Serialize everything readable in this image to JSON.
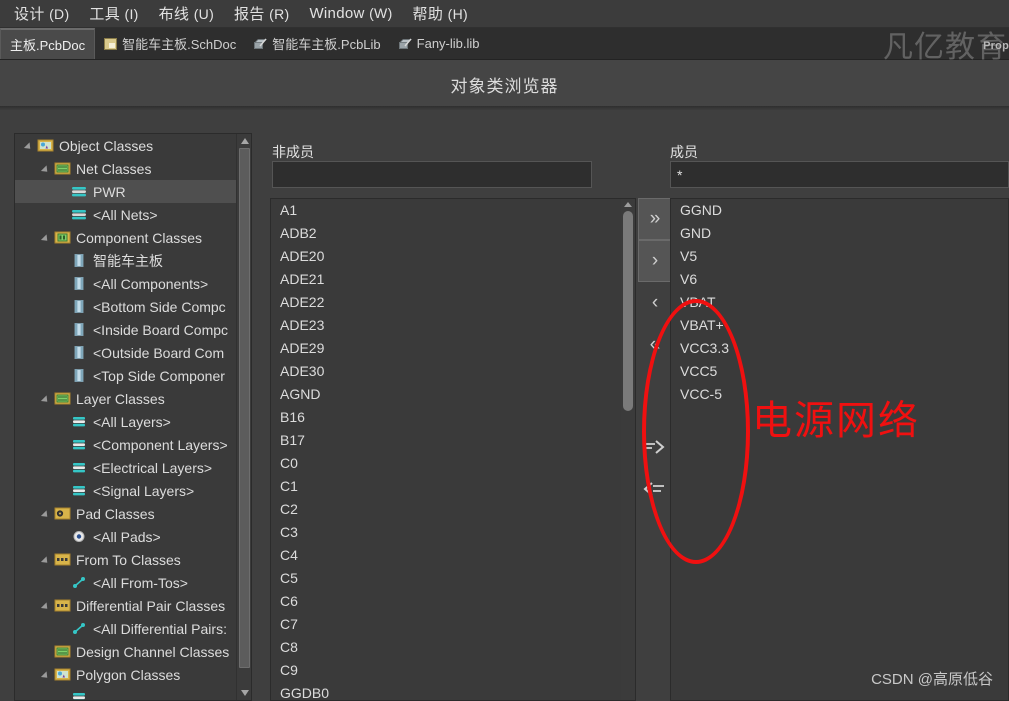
{
  "menubar": {
    "items": [
      {
        "label": "设计",
        "mnemonic": "(D)"
      },
      {
        "label": "工具",
        "mnemonic": "(I)"
      },
      {
        "label": "布线",
        "mnemonic": "(U)"
      },
      {
        "label": "报告",
        "mnemonic": "(R)"
      },
      {
        "label": "Window",
        "mnemonic": "(W)"
      },
      {
        "label": "帮助",
        "mnemonic": "(H)"
      }
    ]
  },
  "tabbar": {
    "tabs": [
      {
        "label": "主板.PcbDoc",
        "icon": "pcb-doc-icon",
        "active": true
      },
      {
        "label": "智能车主板.SchDoc",
        "icon": "sch-doc-icon",
        "active": false
      },
      {
        "label": "智能车主板.PcbLib",
        "icon": "pcb-lib-icon",
        "active": false
      },
      {
        "label": "Fany-lib.lib",
        "icon": "lib-icon",
        "active": false
      }
    ]
  },
  "watermarks": {
    "top_right": "凡亿教育",
    "properties_ghost": "Prop",
    "bottom_right": "CSDN @高原低谷"
  },
  "dialog": {
    "title": "对象类浏览器"
  },
  "tree": {
    "items": [
      {
        "label": "Object Classes",
        "depth": 0,
        "icon": "polygon-class-folder-icon",
        "expander": true,
        "selected": false
      },
      {
        "label": "Net Classes",
        "depth": 1,
        "icon": "net-class-folder-icon",
        "expander": true,
        "selected": false
      },
      {
        "label": "PWR",
        "depth": 2,
        "icon": "net-icon",
        "expander": false,
        "selected": true
      },
      {
        "label": "<All Nets>",
        "depth": 2,
        "icon": "net-icon",
        "expander": false,
        "selected": false
      },
      {
        "label": "Component Classes",
        "depth": 1,
        "icon": "component-class-folder-icon",
        "expander": true,
        "selected": false
      },
      {
        "label": "智能车主板",
        "depth": 2,
        "icon": "component-icon",
        "expander": false,
        "selected": false
      },
      {
        "label": "<All Components>",
        "depth": 2,
        "icon": "component-icon",
        "expander": false,
        "selected": false
      },
      {
        "label": "<Bottom Side Compc",
        "depth": 2,
        "icon": "component-icon",
        "expander": false,
        "selected": false
      },
      {
        "label": "<Inside Board Compc",
        "depth": 2,
        "icon": "component-icon",
        "expander": false,
        "selected": false
      },
      {
        "label": "<Outside Board Com",
        "depth": 2,
        "icon": "component-icon",
        "expander": false,
        "selected": false
      },
      {
        "label": "<Top Side Componer",
        "depth": 2,
        "icon": "component-icon",
        "expander": false,
        "selected": false
      },
      {
        "label": "Layer Classes",
        "depth": 1,
        "icon": "layer-class-folder-icon",
        "expander": true,
        "selected": false
      },
      {
        "label": "<All Layers>",
        "depth": 2,
        "icon": "layer-icon",
        "expander": false,
        "selected": false
      },
      {
        "label": "<Component Layers>",
        "depth": 2,
        "icon": "layer-icon",
        "expander": false,
        "selected": false
      },
      {
        "label": "<Electrical Layers>",
        "depth": 2,
        "icon": "layer-icon",
        "expander": false,
        "selected": false
      },
      {
        "label": "<Signal Layers>",
        "depth": 2,
        "icon": "layer-icon",
        "expander": false,
        "selected": false
      },
      {
        "label": "Pad Classes",
        "depth": 1,
        "icon": "pad-class-folder-icon",
        "expander": true,
        "selected": false
      },
      {
        "label": "<All Pads>",
        "depth": 2,
        "icon": "pad-icon",
        "expander": false,
        "selected": false
      },
      {
        "label": "From To Classes",
        "depth": 1,
        "icon": "fromto-class-folder-icon",
        "expander": true,
        "selected": false
      },
      {
        "label": "<All From-Tos>",
        "depth": 2,
        "icon": "fromto-icon",
        "expander": false,
        "selected": false
      },
      {
        "label": "Differential Pair Classes",
        "depth": 1,
        "icon": "diffpair-class-folder-icon",
        "expander": true,
        "selected": false
      },
      {
        "label": "<All Differential Pairs:",
        "depth": 2,
        "icon": "diffpair-icon",
        "expander": false,
        "selected": false
      },
      {
        "label": "Design Channel Classes",
        "depth": 1,
        "icon": "design-channel-folder-icon",
        "expander": false,
        "selected": false
      },
      {
        "label": "Polygon Classes",
        "depth": 1,
        "icon": "polygon-class-folder-icon",
        "expander": true,
        "selected": false
      },
      {
        "label": "",
        "depth": 2,
        "icon": "layer-icon",
        "expander": false,
        "selected": false
      }
    ]
  },
  "nonmembers": {
    "label": "非成员",
    "filter_value": "",
    "filter_placeholder": "",
    "items": [
      "A1",
      "ADB2",
      "ADE20",
      "ADE21",
      "ADE22",
      "ADE23",
      "ADE29",
      "ADE30",
      "AGND",
      "B16",
      "B17",
      "C0",
      "C1",
      "C2",
      "C3",
      "C4",
      "C5",
      "C6",
      "C7",
      "C8",
      "C9",
      "GGDB0"
    ]
  },
  "members": {
    "label": "成员",
    "filter_value": "*",
    "filter_placeholder": "",
    "items": [
      "GGND",
      "GND",
      "V5",
      "V6",
      "VBAT",
      "VBAT+",
      "VCC3.3",
      "VCC5",
      "VCC-5"
    ]
  },
  "transfer_buttons": [
    {
      "name": "add-all-button",
      "glyph": "»",
      "raised": true
    },
    {
      "name": "add-button",
      "glyph": "›",
      "raised": true
    },
    {
      "name": "remove-button",
      "glyph": "‹",
      "raised": false
    },
    {
      "name": "remove-all-button",
      "glyph": "«",
      "raised": false
    },
    {
      "name": "add-filtered-button",
      "glyph": "≡›",
      "raised": false
    },
    {
      "name": "remove-filtered-button",
      "glyph": "‹≡",
      "raised": false
    }
  ],
  "annotation": {
    "text": "电源网络",
    "color": "#f01010"
  },
  "colors": {
    "window_bg": "#3f3f3f",
    "panel_bg": "#3a3a3a",
    "titlebar_bg": "#454545",
    "selection": "#4f4f4f",
    "text": "#dcdcdc",
    "net_icon": "#35c6c6",
    "folder_icon": "#d8b44a",
    "annotation_red": "#f01010"
  }
}
